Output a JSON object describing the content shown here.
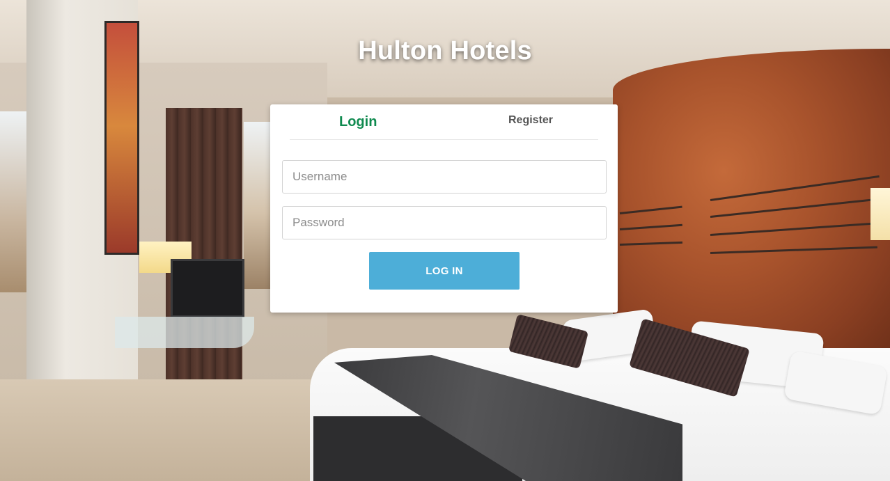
{
  "brand": {
    "title": "Hulton Hotels"
  },
  "tabs": {
    "login": "Login",
    "register": "Register",
    "active": "login"
  },
  "form": {
    "username_placeholder": "Username",
    "password_placeholder": "Password",
    "submit_label": "LOG IN"
  },
  "colors": {
    "active_tab": "#0f8a4f",
    "inactive_tab": "#555555",
    "button": "#4daed8",
    "card": "#ffffff"
  }
}
